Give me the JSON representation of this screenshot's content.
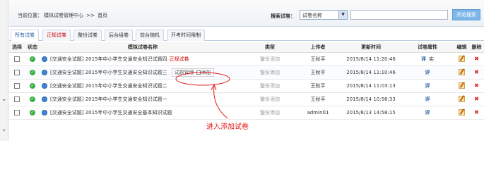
{
  "breadcrumb": {
    "prefix": "当前位置：",
    "section": "模拟试卷管理中心",
    "separator": ">>",
    "current": "首页"
  },
  "search": {
    "label": "搜索试卷：",
    "select_value": "试卷名称",
    "button": "开始搜索"
  },
  "tabs": [
    {
      "label": "所有试卷"
    },
    {
      "label": "正规试卷"
    },
    {
      "label": "整份试卷"
    },
    {
      "label": "后台组卷"
    },
    {
      "label": "前台随机"
    },
    {
      "label": "开考时间限制"
    }
  ],
  "columns": [
    "选择",
    "状态",
    "模拟试卷名称",
    "类型",
    "上传者",
    "更新时间",
    "试卷属性",
    "编辑",
    "删除"
  ],
  "rows": [
    {
      "name": "[交通安全试题] 2015年中小学生交通安全知识试题四",
      "tag": "正规试卷",
      "type": "整份添加",
      "uploader": "王秋平",
      "time": "2015/8/14 11:20:46",
      "attr1": "评",
      "attr2": "实"
    },
    {
      "name": "[交通安全试题] 2015年中小学生交通安全知识试题三",
      "popup_link": "试题管理",
      "popup_check": "添加",
      "type": "整份添加",
      "uploader": "王秋平",
      "time": "2015/8/14 11:10:46",
      "attr1": "评"
    },
    {
      "name": "[交通安全试题] 2015年中小学生交通安全知识试题二",
      "type": "整份添加",
      "uploader": "王秋平",
      "time": "2015/8/14 11:03:13",
      "attr1": "评"
    },
    {
      "name": "[交通安全试题] 2015年中小学生交通安全知识试题一",
      "type": "整份添加",
      "uploader": "王秋平",
      "time": "2015/8/14 10:56:33",
      "attr1": "评"
    },
    {
      "name": "[交通安全试题] 2015年中小学生交通安全基本知识试题",
      "type": "整份添加",
      "uploader": "admin01",
      "time": "2015/8/13 14:58:15",
      "attr1": "评"
    }
  ],
  "annotation": {
    "text": "进入添加试卷",
    "color": "#e21a1a"
  },
  "colors": {
    "accent": "#2a5fa8",
    "red": "#cc0000",
    "ok_green": "#3bae45",
    "button_blue": "#7db6e8"
  },
  "icons": {
    "status": "check-circle-icon",
    "globe": "globe-icon",
    "edit": "pencil-icon",
    "delete": "x-icon"
  }
}
